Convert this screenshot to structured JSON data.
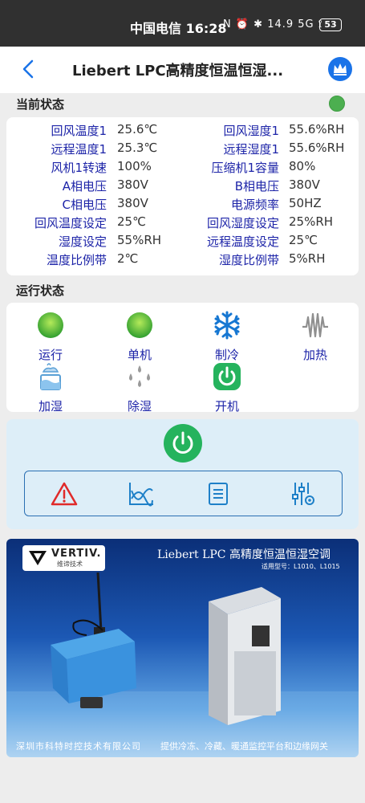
{
  "status_bar": {
    "carrier_time": "中国电信 16:28",
    "indicators": "N ⏰ ✱ 14.9 5G ⟟",
    "battery": "53"
  },
  "nav": {
    "title": "Liebert LPC高精度恒温恒湿..."
  },
  "current_status": {
    "title": "当前状态",
    "rows": [
      {
        "l_label": "回风温度1",
        "l_value": "25.6℃",
        "r_label": "回风湿度1",
        "r_value": "55.6%RH"
      },
      {
        "l_label": "远程温度1",
        "l_value": "25.3℃",
        "r_label": "远程湿度1",
        "r_value": "55.6%RH"
      },
      {
        "l_label": "风机1转速",
        "l_value": "100%",
        "r_label": "压缩机1容量",
        "r_value": "80%"
      },
      {
        "l_label": "A相电压",
        "l_value": "380V",
        "r_label": "B相电压",
        "r_value": "380V"
      },
      {
        "l_label": "C相电压",
        "l_value": "380V",
        "r_label": "电源频率",
        "r_value": "50HZ"
      },
      {
        "l_label": "回风温度设定",
        "l_value": "25℃",
        "r_label": "回风湿度设定",
        "r_value": "25%RH"
      },
      {
        "l_label": "湿度设定",
        "l_value": "55%RH",
        "r_label": "远程温度设定",
        "r_value": "25℃"
      },
      {
        "l_label": "温度比例带",
        "l_value": "2℃",
        "r_label": "湿度比例带",
        "r_value": "5%RH"
      }
    ]
  },
  "run_status": {
    "title": "运行状态",
    "items": [
      {
        "label": "运行",
        "icon": "green-dot-icon"
      },
      {
        "label": "单机",
        "icon": "green-dot-icon"
      },
      {
        "label": "制冷",
        "icon": "snowflake-icon"
      },
      {
        "label": "加热",
        "icon": "heater-icon"
      },
      {
        "label": "加湿",
        "icon": "humidifier-icon"
      },
      {
        "label": "除湿",
        "icon": "droplets-icon"
      },
      {
        "label": "开机",
        "icon": "power-on-icon"
      }
    ]
  },
  "toolbar": {
    "items": [
      "alarm-icon",
      "curve-icon",
      "list-icon",
      "settings-icon"
    ]
  },
  "banner": {
    "logo_text": "VERTIV.",
    "logo_sub": "维谛技术",
    "title": "Liebert LPC 高精度恒温恒湿空调",
    "models": "适用型号：L1010、L1015",
    "company": "深圳市科特时控技术有限公司",
    "slogan": "提供冷冻、冷藏、暖通监控平台和边缘网关"
  },
  "colors": {
    "label_blue": "#1d24a8",
    "accent_green": "#25b35d",
    "nav_blue": "#1a73e8"
  }
}
